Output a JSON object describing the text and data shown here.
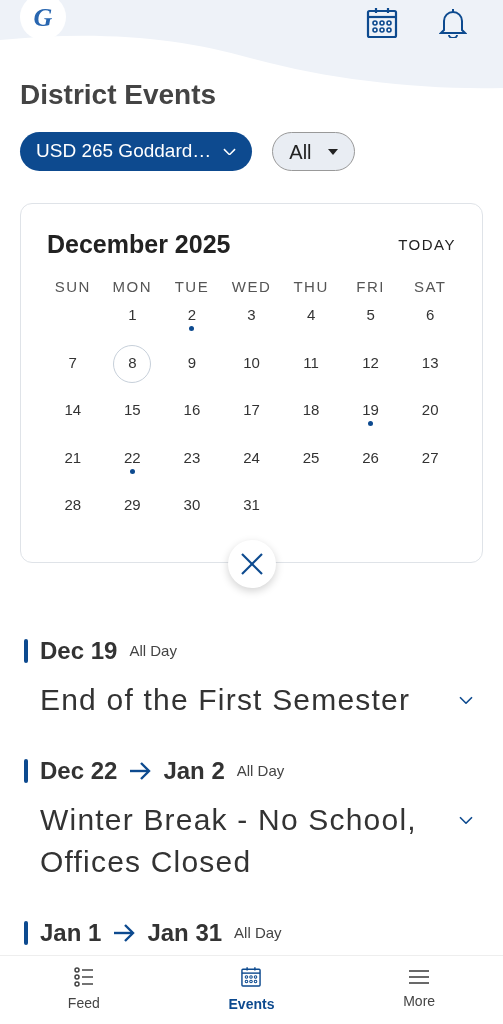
{
  "header": {
    "logo_letter": "G"
  },
  "page_title": "District Events",
  "filters": [
    {
      "kind": "district",
      "label": "USD 265 Goddard…"
    },
    {
      "kind": "category",
      "label": "All"
    }
  ],
  "calendar": {
    "month": "December 2025",
    "today_button": "TODAY",
    "weekdays": [
      "SUN",
      "MON",
      "TUE",
      "WED",
      "THU",
      "FRI",
      "SAT"
    ],
    "weeks": [
      [
        {
          "day": "1",
          "today": false,
          "has_event": false
        },
        {
          "day": "2",
          "today": false,
          "has_event": true
        },
        {
          "day": "3",
          "today": false,
          "has_event": false
        },
        {
          "day": "4",
          "today": false,
          "has_event": false
        },
        {
          "day": "5",
          "today": false,
          "has_event": false
        },
        {
          "day": "6",
          "today": false,
          "has_event": false
        }
      ],
      [
        {
          "day": "7",
          "today": false,
          "has_event": false
        },
        {
          "day": "8",
          "today": true,
          "has_event": false
        },
        {
          "day": "9",
          "today": false,
          "has_event": false
        },
        {
          "day": "10",
          "today": false,
          "has_event": false
        },
        {
          "day": "11",
          "today": false,
          "has_event": false
        },
        {
          "day": "12",
          "today": false,
          "has_event": false
        },
        {
          "day": "13",
          "today": false,
          "has_event": false
        }
      ],
      [
        {
          "day": "14",
          "today": false,
          "has_event": false
        },
        {
          "day": "15",
          "today": false,
          "has_event": false
        },
        {
          "day": "16",
          "today": false,
          "has_event": false
        },
        {
          "day": "17",
          "today": false,
          "has_event": false
        },
        {
          "day": "18",
          "today": false,
          "has_event": false
        },
        {
          "day": "19",
          "today": false,
          "has_event": true
        },
        {
          "day": "20",
          "today": false,
          "has_event": false
        }
      ],
      [
        {
          "day": "21",
          "today": false,
          "has_event": false
        },
        {
          "day": "22",
          "today": false,
          "has_event": true
        },
        {
          "day": "23",
          "today": false,
          "has_event": false
        },
        {
          "day": "24",
          "today": false,
          "has_event": false
        },
        {
          "day": "25",
          "today": false,
          "has_event": false
        },
        {
          "day": "26",
          "today": false,
          "has_event": false
        },
        {
          "day": "27",
          "today": false,
          "has_event": false
        }
      ],
      [
        {
          "day": "28",
          "today": false,
          "has_event": false
        },
        {
          "day": "29",
          "today": false,
          "has_event": false
        },
        {
          "day": "30",
          "today": false,
          "has_event": false
        },
        {
          "day": "31",
          "today": false,
          "has_event": false
        }
      ]
    ]
  },
  "events": [
    {
      "start": "Dec 19",
      "time": "All Day",
      "title": "End of the First Semester",
      "expanded": false
    },
    {
      "start": "Dec 22",
      "end": "Jan 2",
      "time": "All Day",
      "title": "Winter Break - No School, Offices Closed",
      "expanded": false
    },
    {
      "start": "Jan 1",
      "end": "Jan 31",
      "time": "All Day"
    }
  ],
  "bottom_nav": [
    {
      "kind": "feed",
      "label": "Feed",
      "selected": false
    },
    {
      "kind": "events",
      "label": "Events",
      "selected": true
    },
    {
      "kind": "more",
      "label": "More",
      "selected": false
    }
  ]
}
